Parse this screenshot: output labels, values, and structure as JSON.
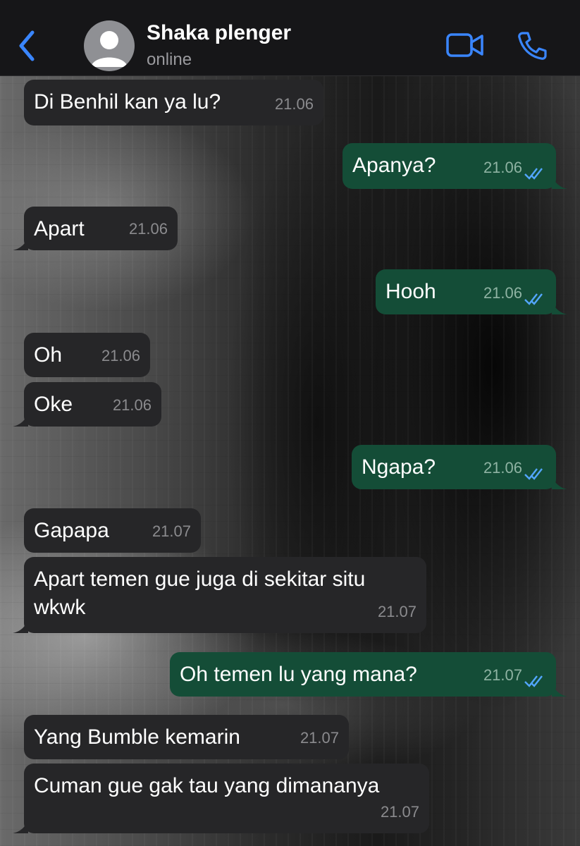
{
  "header": {
    "back_icon": "chevron-left-icon",
    "contact_name": "Shaka plenger",
    "status": "online",
    "video_icon": "video-camera-icon",
    "call_icon": "phone-icon",
    "accent_color": "#3a86ff"
  },
  "colors": {
    "incoming_bubble": "#262628",
    "outgoing_bubble": "#144d37",
    "read_ticks": "#53a6ff"
  },
  "messages": [
    {
      "direction": "incoming",
      "text": "Di Benhil kan ya lu?",
      "time": "21.06"
    },
    {
      "direction": "outgoing",
      "text": "Apanya?",
      "time": "21.06",
      "status": "read"
    },
    {
      "direction": "incoming",
      "text": "Apart",
      "time": "21.06"
    },
    {
      "direction": "outgoing",
      "text": "Hooh",
      "time": "21.06",
      "status": "read"
    },
    {
      "direction": "incoming",
      "text": "Oh",
      "time": "21.06"
    },
    {
      "direction": "incoming",
      "text": "Oke",
      "time": "21.06"
    },
    {
      "direction": "outgoing",
      "text": "Ngapa?",
      "time": "21.06",
      "status": "read"
    },
    {
      "direction": "incoming",
      "text": "Gapapa",
      "time": "21.07"
    },
    {
      "direction": "incoming",
      "text": "Apart temen gue juga di sekitar situ wkwk",
      "time": "21.07"
    },
    {
      "direction": "outgoing",
      "text": "Oh temen lu yang mana?",
      "time": "21.07",
      "status": "read"
    },
    {
      "direction": "incoming",
      "text": "Yang Bumble kemarin",
      "time": "21.07"
    },
    {
      "direction": "incoming",
      "text": "Cuman gue gak tau yang dimananya",
      "time": "21.07"
    }
  ]
}
